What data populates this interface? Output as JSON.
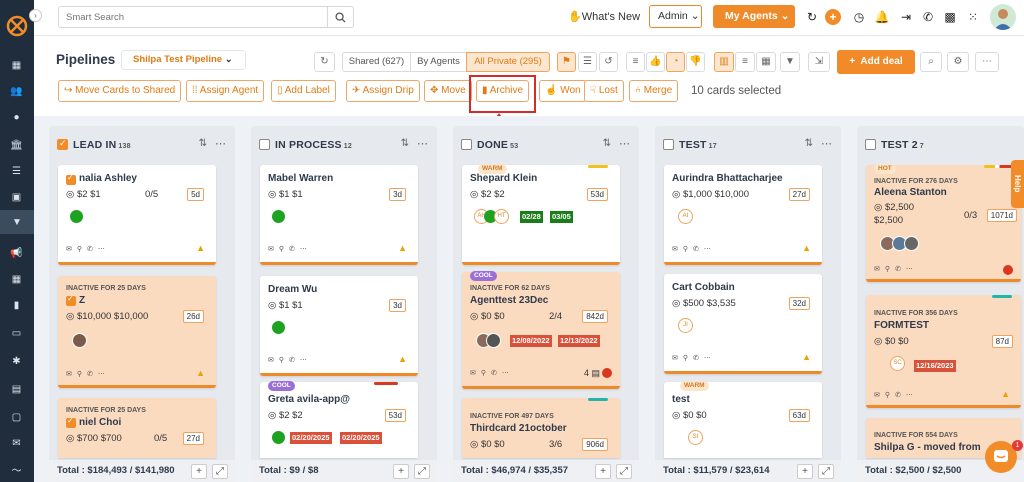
{
  "topbar": {
    "search_placeholder": "Smart Search",
    "whats_new": "What's New",
    "admin_select": "Admin",
    "my_agents": "My Agents"
  },
  "header": {
    "title": "Pipelines",
    "pipeline_select": "Shilpa Test Pipeline",
    "shared": "Shared (627)",
    "by_agents": "By Agents",
    "all_private": "All Private (295)",
    "add_deal": "Add deal"
  },
  "actions": {
    "move_to_shared": "Move Cards to Shared",
    "assign_agent": "Assign Agent",
    "add_label": "Add Label",
    "assign_drip": "Assign Drip",
    "move": "Move",
    "archive": "Archive",
    "won": "Won",
    "lost": "Lost",
    "merge": "Merge",
    "selected_text": "10 cards selected"
  },
  "columns": [
    {
      "name": "LEAD IN",
      "count": "138",
      "total": "Total : $184,493 / $141,980",
      "cards": [
        {
          "title": "nalia Ashley",
          "vals": "$2  $1",
          "ratio": "0/5",
          "age": "5d"
        },
        {
          "inactive": "INACTIVE FOR 25 DAYS",
          "title": "Z",
          "vals": "$10,000  $10,000",
          "age": "26d"
        },
        {
          "inactive": "INACTIVE FOR 25 DAYS",
          "title": "niel Choi",
          "vals": "$700  $700",
          "ratio": "0/5",
          "age": "27d"
        }
      ]
    },
    {
      "name": "IN PROCESS",
      "count": "12",
      "total": "Total : $9 / $8",
      "cards": [
        {
          "title": "Mabel Warren",
          "vals": "$1  $1",
          "age": "3d"
        },
        {
          "title": "Dream Wu",
          "vals": "$1  $1",
          "age": "3d"
        },
        {
          "tag": "COOL",
          "title": "Greta avila-app@",
          "vals": "$2  $2",
          "age": "53d",
          "dates": [
            "02/20/2025",
            "02/20/2025"
          ]
        }
      ]
    },
    {
      "name": "DONE",
      "count": "53",
      "total": "Total : $46,974 / $35,357",
      "cards": [
        {
          "tag": "WARM",
          "title": "Shepard Klein",
          "vals": "$2  $2",
          "age": "53d",
          "initials": [
            "AH",
            "HT"
          ],
          "dates": [
            "02/28",
            "03/05"
          ]
        },
        {
          "tag": "COOL",
          "inactive": "INACTIVE FOR 62 DAYS",
          "title": "Agenttest 23Dec",
          "vals": "$0  $0",
          "ratio": "2/4",
          "age": "842d",
          "dates": [
            "12/08/2022",
            "12/13/2022"
          ],
          "note_count": "4"
        },
        {
          "inactive": "INACTIVE FOR 497 DAYS",
          "title": "Thirdcard 21october",
          "vals": "$0  $0",
          "ratio": "3/6",
          "age": "906d"
        }
      ]
    },
    {
      "name": "TEST",
      "count": "17",
      "total": "Total : $11,579 / $23,614",
      "cards": [
        {
          "title": "Aurindra Bhattacharjee",
          "vals": "$1,000  $10,000",
          "age": "27d",
          "initials": [
            "AI"
          ]
        },
        {
          "title": "Cart Cobbain",
          "vals": "$500  $3,535",
          "age": "32d",
          "initials": [
            "JI"
          ]
        },
        {
          "tag": "WARM",
          "title": "test",
          "vals": "$0  $0",
          "age": "63d",
          "initials": [
            "SI"
          ]
        }
      ]
    },
    {
      "name": "TEST 2",
      "count": "7",
      "total": "Total : $2,500 / $2,500",
      "cards": [
        {
          "tag": "HOT",
          "inactive": "INACTIVE FOR 276 DAYS",
          "title": "Aleena Stanton",
          "vals": "$2,500",
          "vals2": "$2,500",
          "ratio": "0/3",
          "age": "1071d"
        },
        {
          "inactive": "INACTIVE FOR 356 DAYS",
          "title": "FORMTEST",
          "vals": "$0  $0",
          "age": "87d",
          "initials": [
            "SC"
          ],
          "dates": [
            "12/16/2023"
          ]
        },
        {
          "inactive": "INACTIVE FOR 554 DAYS",
          "title": "Shilpa G - moved from"
        }
      ]
    }
  ],
  "help_tab": "Help",
  "chat_badge": "1",
  "colors": {
    "accent": "#f28c28",
    "peach": "#fbdbc0",
    "red_date": "#d9513a",
    "green_date": "#1a7d1a",
    "highlight": "#d42b2b"
  }
}
